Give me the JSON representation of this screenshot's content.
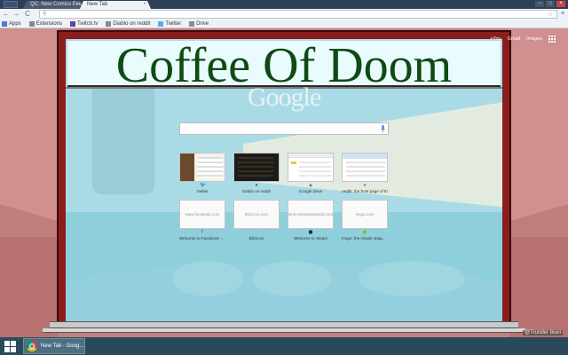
{
  "tabs": [
    {
      "label": "QC: New Comics Eve",
      "close": "×"
    },
    {
      "label": "New Tab",
      "close": "×"
    }
  ],
  "toolbar": {
    "back": "←",
    "forward": "→",
    "reload": "C",
    "address_value": "",
    "address_placeholder": "",
    "star": "☆",
    "menu": "≡"
  },
  "bookmarks": [
    {
      "label": "Apps",
      "icon": "apps-icon",
      "color": "#4a7fd4"
    },
    {
      "label": "Extensions",
      "icon": "page-icon",
      "color": "#8a8a8a"
    },
    {
      "label": "Twitch.tv",
      "icon": "twitch-icon",
      "color": "#6441a5"
    },
    {
      "label": "Diablo on reddit",
      "icon": "reddit-icon",
      "color": "#8a8a8a"
    },
    {
      "label": "Twitter",
      "icon": "twitter-icon",
      "color": "#55acee"
    },
    {
      "label": "Drive",
      "icon": "drive-icon",
      "color": "#8a8a8a"
    }
  ],
  "theme": {
    "sign_title": "Coffee Of Doom",
    "sign_color": "#0f4a13",
    "frame_color": "#8b1d1d",
    "wall_color": "#c47f7f",
    "credit": "@Trunder Ikuvi"
  },
  "ntp": {
    "links": [
      "+You",
      "Gmail",
      "Images"
    ],
    "logo": "Google",
    "search_value": "",
    "search_placeholder": "",
    "tiles": [
      {
        "title": "Twitter",
        "kind": "twitter",
        "favicon": "twitter-icon",
        "glyph": "🐦",
        "color": "#55acee"
      },
      {
        "title": "Diablo on reddit",
        "kind": "diablo",
        "favicon": "reddit-icon",
        "glyph": "●",
        "color": "#666666"
      },
      {
        "title": "Google Drive",
        "kind": "drive",
        "favicon": "drive-icon",
        "glyph": "▲",
        "color": "#0f9d58"
      },
      {
        "title": "reddit: the front page of th",
        "kind": "reddit",
        "favicon": "reddit-icon",
        "glyph": "●",
        "color": "#888888"
      },
      {
        "title": "Welcome to Facebook - Lo",
        "kind": "url",
        "url": "www.facebook.com",
        "favicon": "facebook-icon",
        "glyph": "f",
        "color": "#3b5998"
      },
      {
        "title": "Blizzcon",
        "kind": "url",
        "url": "blizzcon.com",
        "favicon": "page-icon",
        "glyph": "▫",
        "color": "#999999"
      },
      {
        "title": "Welcome to Steam",
        "kind": "url",
        "url": "store.steampowered.com",
        "favicon": "steam-icon",
        "glyph": "◼",
        "color": "#1b2838"
      },
      {
        "title": "Imgur: the simple image sh",
        "kind": "url",
        "url": "imgur.com",
        "favicon": "imgur-icon",
        "glyph": "◼",
        "color": "#85bf25"
      }
    ]
  },
  "taskbar": {
    "item_label": "New Tab - Goog..."
  }
}
